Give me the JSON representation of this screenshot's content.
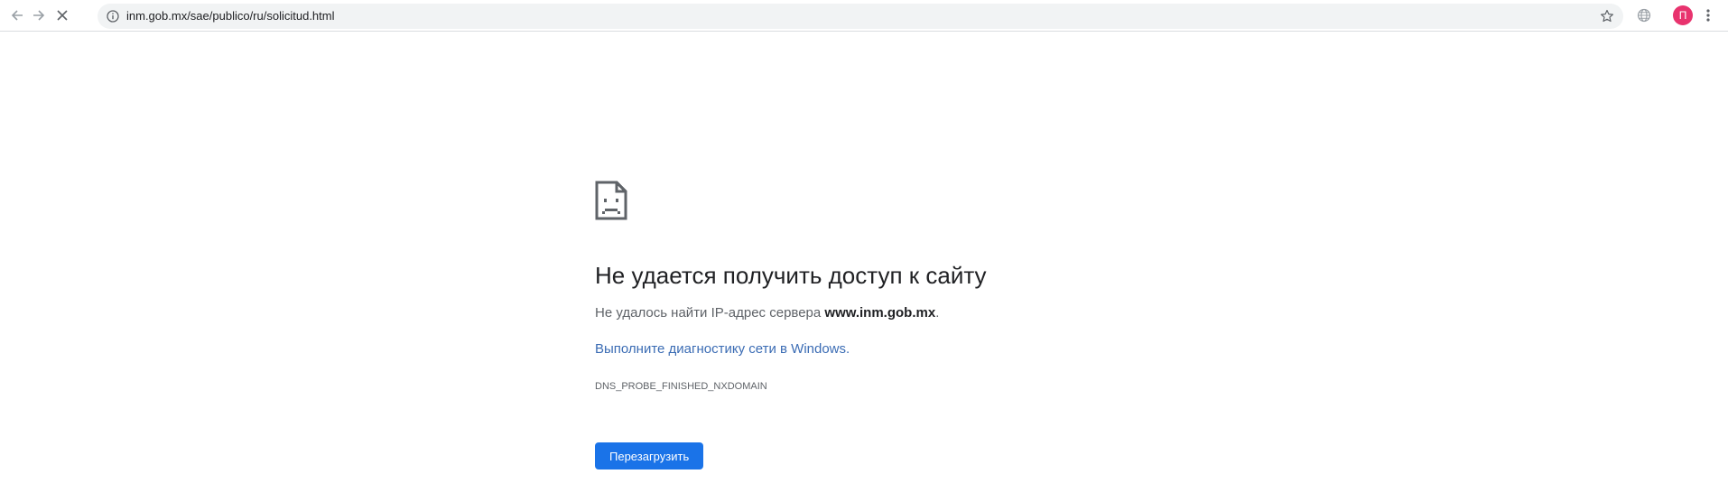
{
  "toolbar": {
    "back_icon": "arrow-left-icon",
    "forward_icon": "arrow-right-icon",
    "stop_icon": "close-icon",
    "url": "inm.gob.mx/sae/publico/ru/solicitud.html",
    "info_icon": "info-icon",
    "bookmark_icon": "star-icon",
    "extension_icon": "globe-icon",
    "avatar_letter": "П",
    "avatar_color": "#e8336e",
    "menu_icon": "kebab-menu-icon"
  },
  "error": {
    "icon": "sad-page-icon",
    "title": "Не удается получить доступ к сайту",
    "desc_prefix": "Не удалось найти IP-адрес сервера ",
    "desc_host": "www.inm.gob.mx",
    "desc_suffix": ".",
    "link_text": "Выполните диагностику сети в Windows.",
    "code": "DNS_PROBE_FINISHED_NXDOMAIN",
    "reload_label": "Перезагрузить"
  },
  "colors": {
    "accent": "#1a73e8",
    "link": "#3b6cb4",
    "omnibox_bg": "#f1f3f4"
  }
}
